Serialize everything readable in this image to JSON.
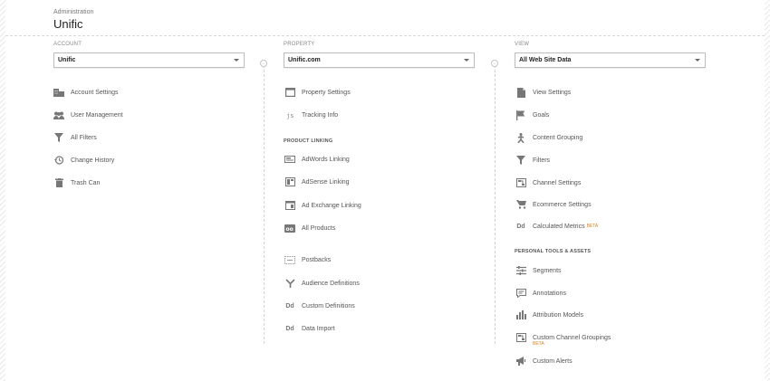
{
  "header": {
    "breadcrumb": "Administration",
    "title": "Unific"
  },
  "account": {
    "label": "ACCOUNT",
    "selected": "Unific",
    "items": [
      {
        "label": "Account Settings",
        "icon": "building-icon"
      },
      {
        "label": "User Management",
        "icon": "users-icon"
      },
      {
        "label": "All Filters",
        "icon": "filter-icon"
      },
      {
        "label": "Change History",
        "icon": "history-icon"
      },
      {
        "label": "Trash Can",
        "icon": "trash-icon"
      }
    ]
  },
  "property": {
    "label": "PROPERTY",
    "selected": "Unific.com",
    "items": [
      {
        "label": "Property Settings",
        "icon": "window-icon"
      },
      {
        "label": "Tracking Info",
        "icon": "js-icon"
      }
    ],
    "product_linking_title": "PRODUCT LINKING",
    "linking": [
      {
        "label": "AdWords Linking",
        "icon": "adwords-icon"
      },
      {
        "label": "AdSense Linking",
        "icon": "adsense-icon"
      },
      {
        "label": "Ad Exchange Linking",
        "icon": "adexchange-icon"
      },
      {
        "label": "All Products",
        "icon": "products-icon"
      }
    ],
    "more": [
      {
        "label": "Postbacks",
        "icon": "postbacks-icon"
      },
      {
        "label": "Audience Definitions",
        "icon": "audience-icon"
      },
      {
        "label": "Custom Definitions",
        "icon": "dd-icon",
        "glyph": "Dd"
      },
      {
        "label": "Data Import",
        "icon": "dd-icon",
        "glyph": "Dd"
      }
    ]
  },
  "view": {
    "label": "VIEW",
    "selected": "All Web Site Data",
    "items": [
      {
        "label": "View Settings",
        "icon": "document-icon"
      },
      {
        "label": "Goals",
        "icon": "flag-icon"
      },
      {
        "label": "Content Grouping",
        "icon": "person-walk-icon"
      },
      {
        "label": "Filters",
        "icon": "filter-icon"
      },
      {
        "label": "Channel Settings",
        "icon": "channel-icon"
      },
      {
        "label": "Ecommerce Settings",
        "icon": "cart-icon"
      },
      {
        "label": "Calculated Metrics",
        "icon": "dd-icon",
        "glyph": "Dd",
        "beta": "BETA"
      }
    ],
    "personal_title": "PERSONAL TOOLS & ASSETS",
    "personal": [
      {
        "label": "Segments",
        "icon": "segments-icon"
      },
      {
        "label": "Annotations",
        "icon": "annotation-icon"
      },
      {
        "label": "Attribution Models",
        "icon": "bar-chart-icon"
      },
      {
        "label": "Custom Channel Groupings",
        "icon": "channel-icon",
        "beta": "BETA"
      },
      {
        "label": "Custom Alerts",
        "icon": "megaphone-icon"
      }
    ]
  }
}
